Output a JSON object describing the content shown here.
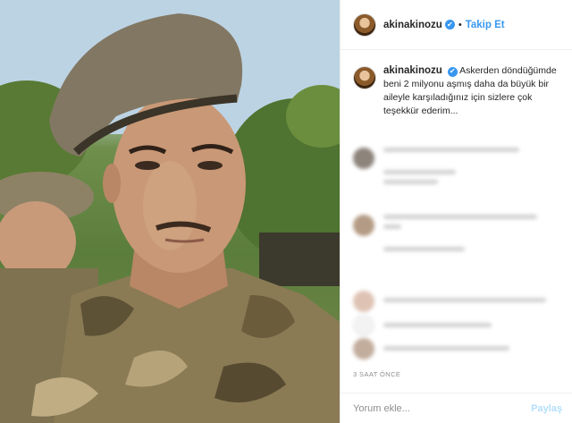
{
  "post": {
    "username": "akinakinozu",
    "follow_label": "Takip Et",
    "separator": "•",
    "verified_glyph": "✔",
    "caption": "Askerden döndüğümde beni 2 milyonu aşmış daha da büyük bir aileyle karşıladığınız için sizlere çok teşekkür ederim...",
    "timestamp": "3 SAAT ÖNCE",
    "comment_placeholder": "Yorum ekle...",
    "share_label": "Paylaş"
  },
  "colors": {
    "link_blue": "#3897f0",
    "share_disabled": "#b2dffc",
    "muted_text": "#8e8e8e"
  },
  "icons": {
    "verified": "verified-badge-icon"
  }
}
